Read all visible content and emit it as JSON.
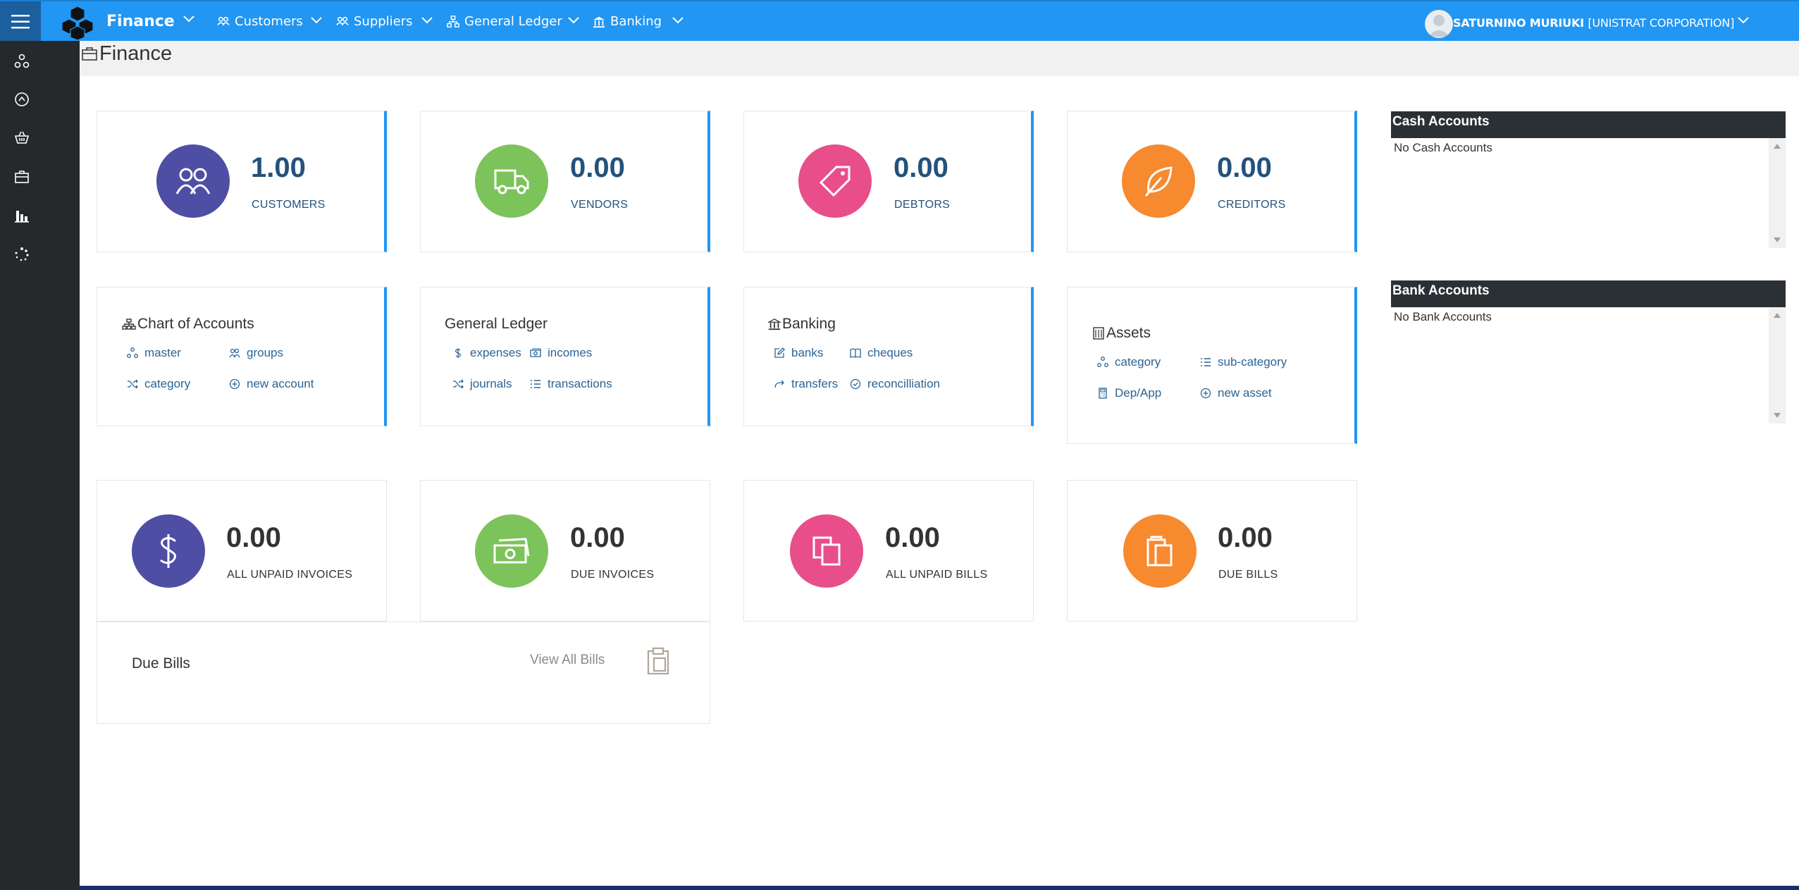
{
  "topbar": {
    "app_title": "Finance",
    "nav": [
      {
        "label": "Customers"
      },
      {
        "label": "Suppliers"
      },
      {
        "label": "General Ledger"
      },
      {
        "label": "Banking"
      }
    ],
    "user_name": "SATURNINO MURIUKI",
    "user_org": "[UNISTRAT CORPORATION]"
  },
  "sidebar": {
    "icons": [
      "sitemap-icon",
      "compass-icon",
      "basket-icon",
      "briefcase-icon",
      "bar-chart-icon",
      "spinner-icon"
    ]
  },
  "page": {
    "title": "Finance"
  },
  "stats_top": [
    {
      "value": "1.00",
      "label": "CUSTOMERS",
      "icon": "users-icon",
      "color": "#4e4ea4"
    },
    {
      "value": "0.00",
      "label": "VENDORS",
      "icon": "truck-icon",
      "color": "#7cc35b"
    },
    {
      "value": "0.00",
      "label": "DEBTORS",
      "icon": "tag-icon",
      "color": "#e84e8a"
    },
    {
      "value": "0.00",
      "label": "CREDITORS",
      "icon": "leaf-icon",
      "color": "#f7892e"
    }
  ],
  "link_cards": {
    "chart_of_accounts": {
      "title": "Chart of Accounts",
      "links": [
        "master",
        "groups",
        "category",
        "new account"
      ]
    },
    "general_ledger": {
      "title": "General Ledger",
      "links": [
        "expenses",
        "incomes",
        "journals",
        "transactions"
      ]
    },
    "banking": {
      "title": "Banking",
      "links": [
        "banks",
        "cheques",
        "transfers",
        "reconcilliation"
      ]
    },
    "assets": {
      "title": "Assets",
      "links": [
        "category",
        "sub-category",
        "Dep/App",
        "new asset"
      ]
    }
  },
  "stats_bottom": [
    {
      "value": "0.00",
      "label": "ALL UNPAID INVOICES",
      "icon": "dollar-icon",
      "color": "#4e4ea4"
    },
    {
      "value": "0.00",
      "label": "DUE INVOICES",
      "icon": "money-icon",
      "color": "#7cc35b"
    },
    {
      "value": "0.00",
      "label": "ALL UNPAID BILLS",
      "icon": "copy-icon",
      "color": "#e84e8a"
    },
    {
      "value": "0.00",
      "label": "DUE BILLS",
      "icon": "clipboard-icon",
      "color": "#f7892e"
    }
  ],
  "due_bills": {
    "title": "Due Bills",
    "view_all": "View All Bills"
  },
  "cash_accounts": {
    "title": "Cash Accounts",
    "empty": "No Cash Accounts"
  },
  "bank_accounts": {
    "title": "Bank Accounts",
    "empty": "No Bank Accounts"
  }
}
